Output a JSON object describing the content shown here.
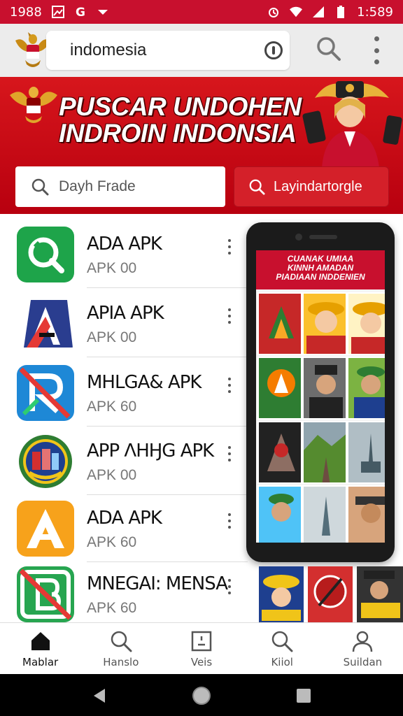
{
  "status_bar": {
    "time_left": "1988",
    "time_right": "1:589"
  },
  "address_bar": {
    "url": "indomesia"
  },
  "banner": {
    "title_line1": "PUSCAR UNDOHEN",
    "title_line2": "INDROIN INDONSIA",
    "search_placeholder": "Dayh Frade",
    "search_button": "Layindartorgle"
  },
  "apps": [
    {
      "name": "ADA APK",
      "sub": "APK 00",
      "color": "#1ea44a",
      "icon": "search-icon"
    },
    {
      "name": "APIA APK",
      "sub": "APK 00",
      "color": "#2a3d8f",
      "icon": "letter-a-icon"
    },
    {
      "name": "MHLGA& APK",
      "sub": "APK 60",
      "color": "#1e88d6",
      "icon": "letter-r-icon"
    },
    {
      "name": "APP ΛHӇG APK",
      "sub": "APK 00",
      "color": "#2f6fb0",
      "icon": "crest-icon"
    },
    {
      "name": "ADA APK",
      "sub": "APK 60",
      "color": "#f7a21b",
      "icon": "letter-a-icon"
    },
    {
      "name": "MNEGAI: MENSA",
      "sub": "APK 60",
      "color": "#27a550",
      "icon": "letter-b-icon"
    }
  ],
  "phone_mockup": {
    "header_line1": "CUANAK UMIAA",
    "header_line2": "KINNH AMADAN",
    "header_line3": "PIADIAAN INDDENIEN"
  },
  "bottom_nav": [
    {
      "label": "Mablar",
      "icon": "home-icon"
    },
    {
      "label": "Hanslo",
      "icon": "search-icon"
    },
    {
      "label": "Veis",
      "icon": "tablet-icon"
    },
    {
      "label": "Kiiol",
      "icon": "search-icon"
    },
    {
      "label": "Suildan",
      "icon": "person-icon"
    }
  ],
  "colors": {
    "brand_red": "#c8102e",
    "accent_red": "#d42029"
  }
}
